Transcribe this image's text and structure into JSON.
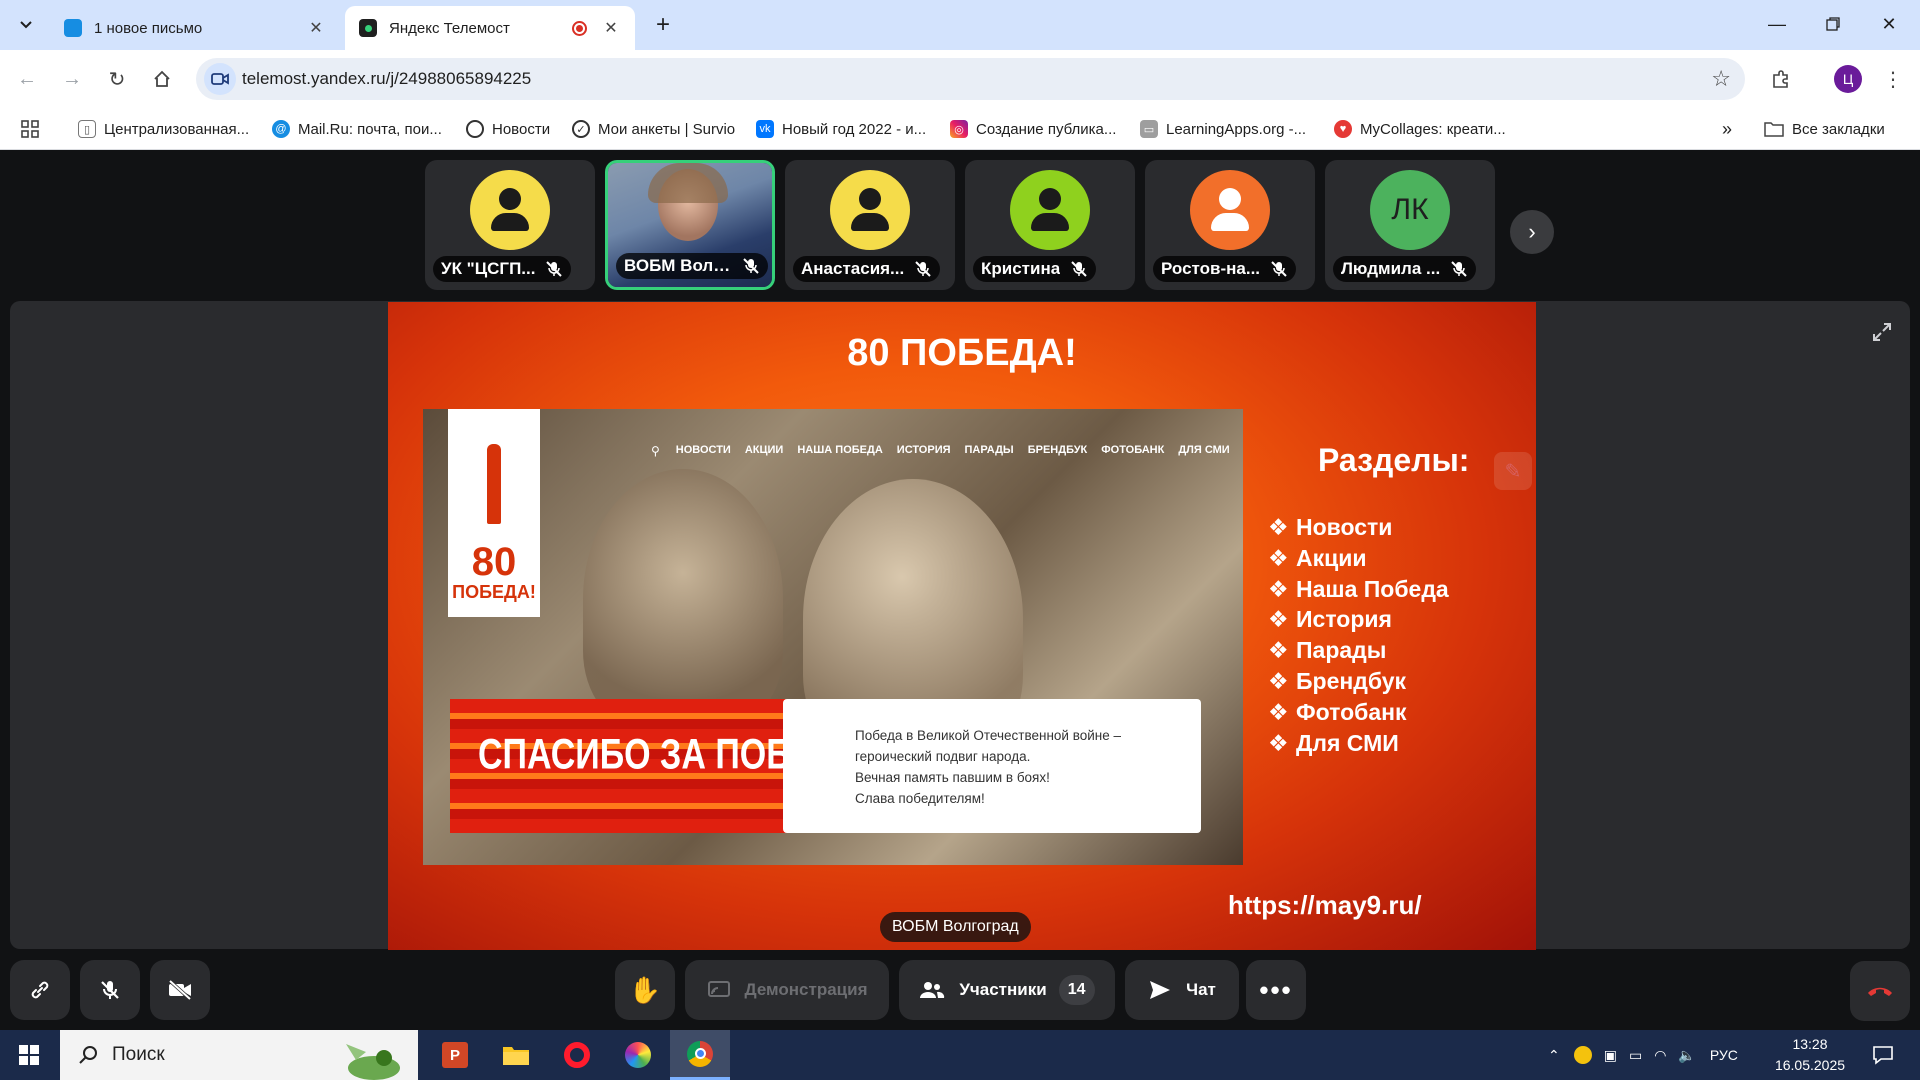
{
  "browser": {
    "tabs": [
      {
        "title": "1 новое письмо",
        "active": false
      },
      {
        "title": "Яндекс Телемост",
        "active": true
      }
    ],
    "url": "telemost.yandex.ru/j/24988065894225",
    "profile_initial": "Ц",
    "bookmarks": [
      {
        "label": "Централизованная...",
        "icon": "book-icon"
      },
      {
        "label": "Mail.Ru: почта, пои...",
        "icon": "mail-at-icon"
      },
      {
        "label": "Новости",
        "icon": "globe-icon"
      },
      {
        "label": "Мои анкеты | Survio",
        "icon": "check-circle-icon"
      },
      {
        "label": "Новый год 2022 - и...",
        "icon": "vk-icon"
      },
      {
        "label": "Создание публика...",
        "icon": "instagram-icon"
      },
      {
        "label": "LearningApps.org -...",
        "icon": "learningapps-icon"
      },
      {
        "label": "MyCollages: креати...",
        "icon": "heart-icon"
      }
    ],
    "all_bookmarks": "Все закладки"
  },
  "participants": [
    {
      "name": "УК \"ЦСГП...",
      "avatar": "person-icon",
      "color": "#f5dc4a",
      "mic": "off"
    },
    {
      "name": "ВОБМ Волгог...",
      "avatar": "video",
      "color": "#6e86a8",
      "mic": "off",
      "active": true
    },
    {
      "name": "Анастасия...",
      "avatar": "person-icon",
      "color": "#f5dc4a",
      "mic": "off"
    },
    {
      "name": "Кристина",
      "avatar": "person-icon",
      "color": "#8fd11e",
      "mic": "off"
    },
    {
      "name": "Ростов-на...",
      "avatar": "person-icon",
      "color": "#f26f2a",
      "mic": "off"
    },
    {
      "name": "Людмила ...",
      "avatar": "ЛК",
      "color": "#4cb25d",
      "mic": "off"
    }
  ],
  "slide": {
    "title": "80 ПОБЕДА!",
    "logo_number": "80",
    "logo_word": "ПОБЕДА!",
    "site_nav": [
      "НОВОСТИ",
      "АКЦИИ",
      "НАША ПОБЕДА",
      "ИСТОРИЯ",
      "ПАРАДЫ",
      "БРЕНДБУК",
      "ФОТОБАНК",
      "ДЛЯ СМИ"
    ],
    "banner_headline": "СПАСИБО ЗА ПОБЕДУ!",
    "banner_lines": [
      "Победа в Великой Отечественной войне –",
      "героический подвиг народа.",
      "Вечная память павшим в боях!",
      "Слава победителям!"
    ],
    "sections_title": "Разделы:",
    "sections": [
      "Новости",
      "Акции",
      "Наша Победа",
      "История",
      "Парады",
      "Брендбук",
      "Фотобанк",
      "Для СМИ"
    ],
    "url": "https://may9.ru/"
  },
  "speaker": "ВОБМ Волгоград",
  "controls": {
    "demo": "Демонстрация",
    "participants": "Участники",
    "participants_count": "14",
    "chat": "Чат"
  },
  "taskbar": {
    "search_placeholder": "Поиск",
    "lang": "РУС",
    "time": "13:28",
    "date": "16.05.2025"
  }
}
